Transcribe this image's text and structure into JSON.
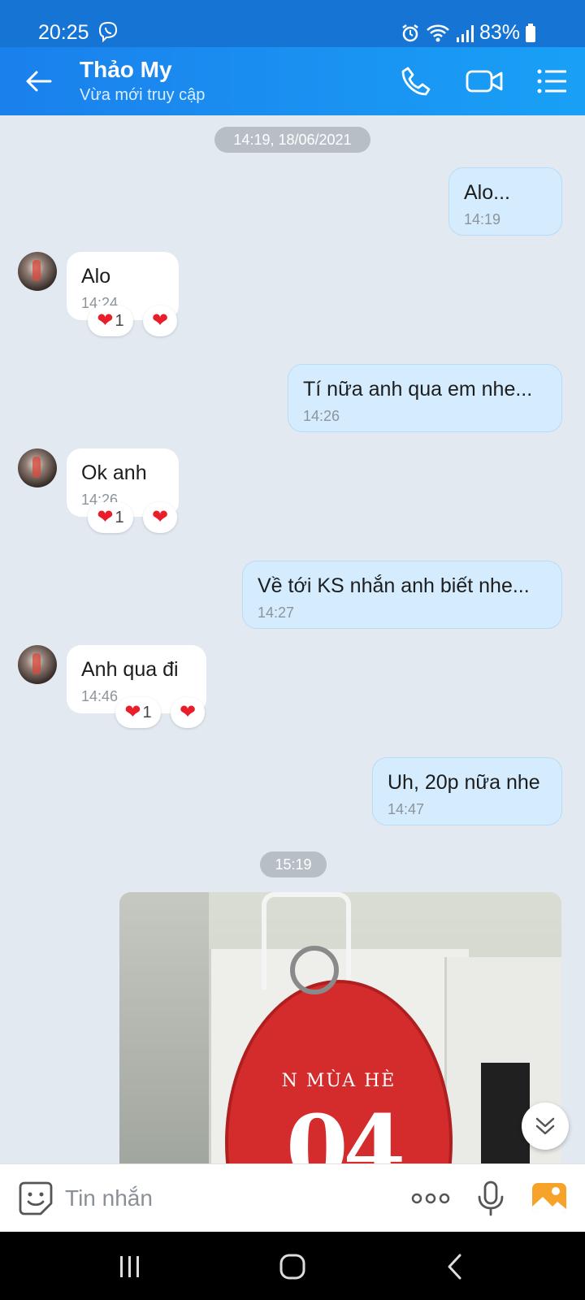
{
  "status_bar": {
    "time": "20:25",
    "battery": "83%"
  },
  "header": {
    "contact_name": "Thảo My",
    "status": "Vừa mới truy cập"
  },
  "chat": {
    "date_separators": [
      "14:19, 18/06/2021",
      "15:19"
    ],
    "messages": [
      {
        "dir": "out",
        "text": "Alo...",
        "time": "14:19"
      },
      {
        "dir": "in",
        "text": "Alo",
        "time": "14:24",
        "reaction_count": "1"
      },
      {
        "dir": "out",
        "text": "Tí nữa anh qua em nhe...",
        "time": "14:26"
      },
      {
        "dir": "in",
        "text": "Ok anh",
        "time": "14:26",
        "reaction_count": "1"
      },
      {
        "dir": "out",
        "text": "Về tới KS nhắn anh biết nhe...",
        "time": "14:27"
      },
      {
        "dir": "in",
        "text": "Anh qua đi",
        "time": "14:46",
        "reaction_count": "1"
      },
      {
        "dir": "out",
        "text": "Uh, 20p nữa nhe",
        "time": "14:47"
      }
    ],
    "photo_tag_text": "N MÙA HÈ",
    "photo_tag_number": "04"
  },
  "input_bar": {
    "placeholder": "Tin nhắn"
  },
  "colors": {
    "header_start": "#1a80ec",
    "header_end": "#19a0f6",
    "outgoing_bubble": "#d4ecfd",
    "incoming_bubble": "#ffffff",
    "chat_background": "#e2e9f1",
    "heart": "#e81e2b"
  },
  "icons": {
    "back": "arrow-left-icon",
    "call": "phone-icon",
    "video": "video-camera-icon",
    "menu": "list-menu-icon",
    "sticker": "sticker-smile-icon",
    "more": "more-dots-icon",
    "mic": "microphone-icon",
    "gallery": "image-gallery-icon",
    "scroll_down": "double-chevron-down-icon"
  }
}
